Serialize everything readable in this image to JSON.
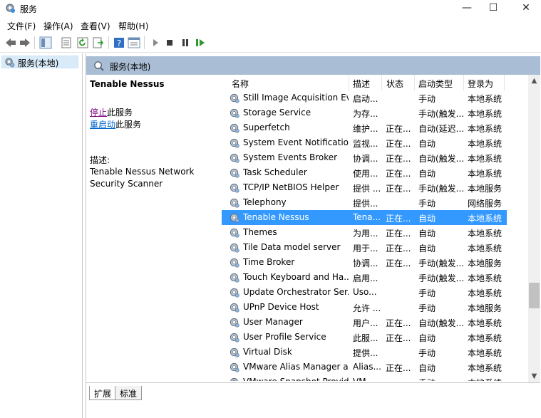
{
  "window": {
    "title": "服务",
    "minimize": "—",
    "maximize": "☐",
    "close": "✕"
  },
  "menu": [
    "文件(F)",
    "操作(A)",
    "查看(V)",
    "帮助(H)"
  ],
  "toolbar_icons": [
    "back-icon",
    "forward-icon",
    "show-tree-icon",
    "properties-icon",
    "refresh-icon",
    "export-icon",
    "help-icon",
    "action-pane-icon",
    "start-service-icon",
    "stop-service-icon",
    "pause-service-icon",
    "restart-service-icon"
  ],
  "tree": {
    "root_label": "服务(本地)"
  },
  "pane": {
    "header_label": "服务(本地)",
    "service_name": "Tenable Nessus",
    "action_stop_link": "停止",
    "action_stop_rest": "此服务",
    "action_restart_link": "重启动",
    "action_restart_rest": "此服务",
    "desc_label": "描述:",
    "desc_text": "Tenable Nessus Network Security Scanner"
  },
  "columns": {
    "name": "名称",
    "desc": "描述",
    "status": "状态",
    "startup": "启动类型",
    "logon": "登录为"
  },
  "rows": [
    {
      "name": "Still Image Acquisition Ev...",
      "desc": "启动...",
      "status": "",
      "startup": "手动",
      "logon": "本地系统"
    },
    {
      "name": "Storage Service",
      "desc": "为存...",
      "status": "",
      "startup": "手动(触发...",
      "logon": "本地系统"
    },
    {
      "name": "Superfetch",
      "desc": "维护...",
      "status": "正在...",
      "startup": "自动(延迟...",
      "logon": "本地系统"
    },
    {
      "name": "System Event Notification...",
      "desc": "监视...",
      "status": "正在...",
      "startup": "自动",
      "logon": "本地系统"
    },
    {
      "name": "System Events Broker",
      "desc": "协调...",
      "status": "正在...",
      "startup": "自动(触发...",
      "logon": "本地系统"
    },
    {
      "name": "Task Scheduler",
      "desc": "使用...",
      "status": "正在...",
      "startup": "自动",
      "logon": "本地系统"
    },
    {
      "name": "TCP/IP NetBIOS Helper",
      "desc": "提供 ...",
      "status": "正在...",
      "startup": "手动(触发...",
      "logon": "本地服务"
    },
    {
      "name": "Telephony",
      "desc": "提供...",
      "status": "",
      "startup": "手动",
      "logon": "网络服务"
    },
    {
      "name": "Tenable Nessus",
      "desc": "Tena...",
      "status": "正在...",
      "startup": "自动",
      "logon": "本地系统",
      "selected": true
    },
    {
      "name": "Themes",
      "desc": "为用...",
      "status": "正在...",
      "startup": "自动",
      "logon": "本地系统"
    },
    {
      "name": "Tile Data model server",
      "desc": "用于...",
      "status": "正在...",
      "startup": "自动",
      "logon": "本地系统"
    },
    {
      "name": "Time Broker",
      "desc": "协调...",
      "status": "正在...",
      "startup": "手动(触发...",
      "logon": "本地服务"
    },
    {
      "name": "Touch Keyboard and Ha...",
      "desc": "启用...",
      "status": "",
      "startup": "手动(触发...",
      "logon": "本地系统"
    },
    {
      "name": "Update Orchestrator Ser...",
      "desc": "Uso...",
      "status": "",
      "startup": "手动",
      "logon": "本地系统"
    },
    {
      "name": "UPnP Device Host",
      "desc": "允许 ...",
      "status": "",
      "startup": "手动",
      "logon": "本地服务"
    },
    {
      "name": "User Manager",
      "desc": "用户...",
      "status": "正在...",
      "startup": "自动(触发...",
      "logon": "本地系统"
    },
    {
      "name": "User Profile Service",
      "desc": "此服...",
      "status": "正在...",
      "startup": "自动",
      "logon": "本地系统"
    },
    {
      "name": "Virtual Disk",
      "desc": "提供...",
      "status": "",
      "startup": "手动",
      "logon": "本地系统"
    },
    {
      "name": "VMware Alias Manager a...",
      "desc": "Alias...",
      "status": "正在...",
      "startup": "自动",
      "logon": "本地系统"
    },
    {
      "name": "VMware Snapshot Provid...",
      "desc": "VM...",
      "status": "",
      "startup": "手动",
      "logon": "本地系统"
    }
  ],
  "tabs": [
    "扩展",
    "标准"
  ],
  "colors": {
    "header_bg": "#a9bed4",
    "selected_row": "#3399ff",
    "tree_selected": "#d9ebf9"
  }
}
